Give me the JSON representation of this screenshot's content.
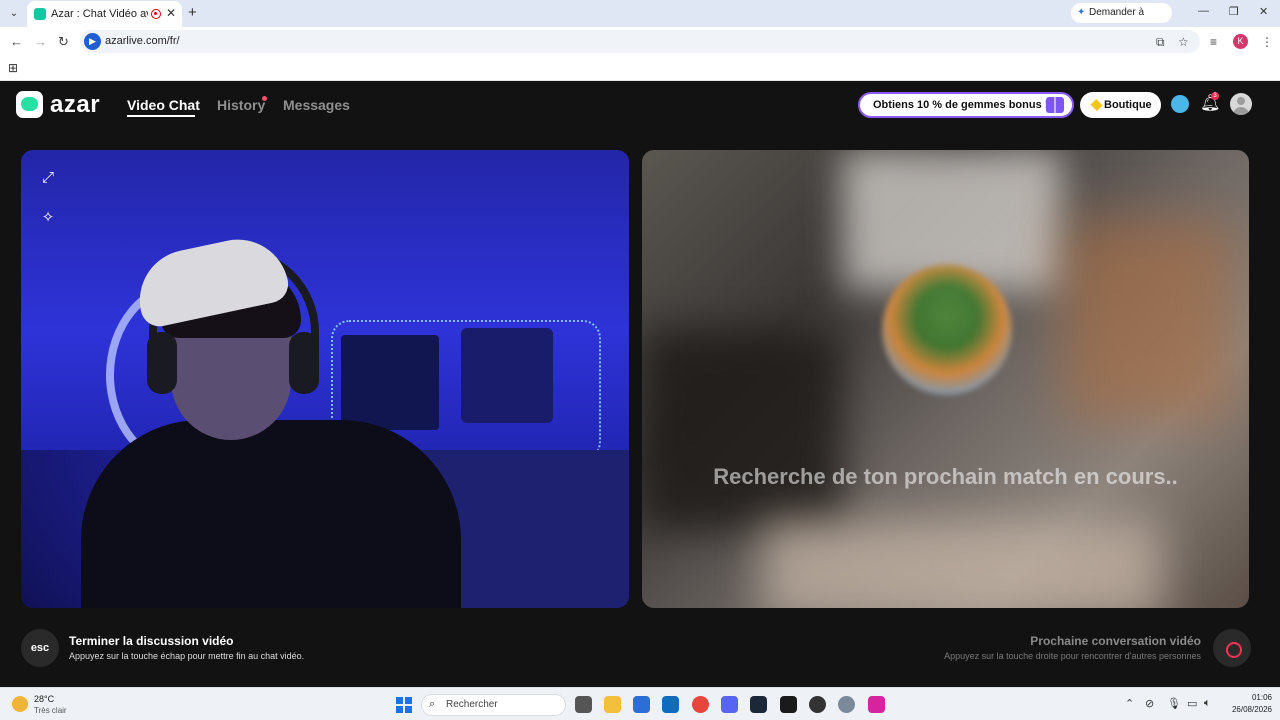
{
  "browser": {
    "tab_title": "Azar : Chat Vidéo avec de n",
    "tab_close": "✕",
    "new_tab": "+",
    "gemini_label": "Demander à Gemini",
    "url": "azarlive.com/fr/",
    "profile_initial": "K"
  },
  "header": {
    "logo_text": "azar",
    "nav": [
      "Video Chat",
      "History",
      "Messages"
    ],
    "promo_label": "Obtiens 10 % de gemmes bonus !",
    "boutique_label": "Boutique",
    "notif_count": "3"
  },
  "remote": {
    "status_text": "Recherche de ton prochain match en cours.."
  },
  "bottom": {
    "esc_label": "esc",
    "end_title": "Terminer la discussion vidéo",
    "end_sub": "Appuyez sur la touche échap pour mettre fin au chat vidéo.",
    "next_title": "Prochaine conversation vidéo",
    "next_sub": "Appuyez sur la touche droite pour rencontrer d'autres personnes"
  },
  "taskbar": {
    "temp": "28°C",
    "weather": "Très clair",
    "search_placeholder": "Rechercher",
    "time": "01:06",
    "date": "26/08/2026"
  },
  "colors": {
    "accent_green": "#27e0a3",
    "promo_border": "#8a5cf6",
    "notif_red": "#ff2b55",
    "page_bg": "#121212"
  }
}
